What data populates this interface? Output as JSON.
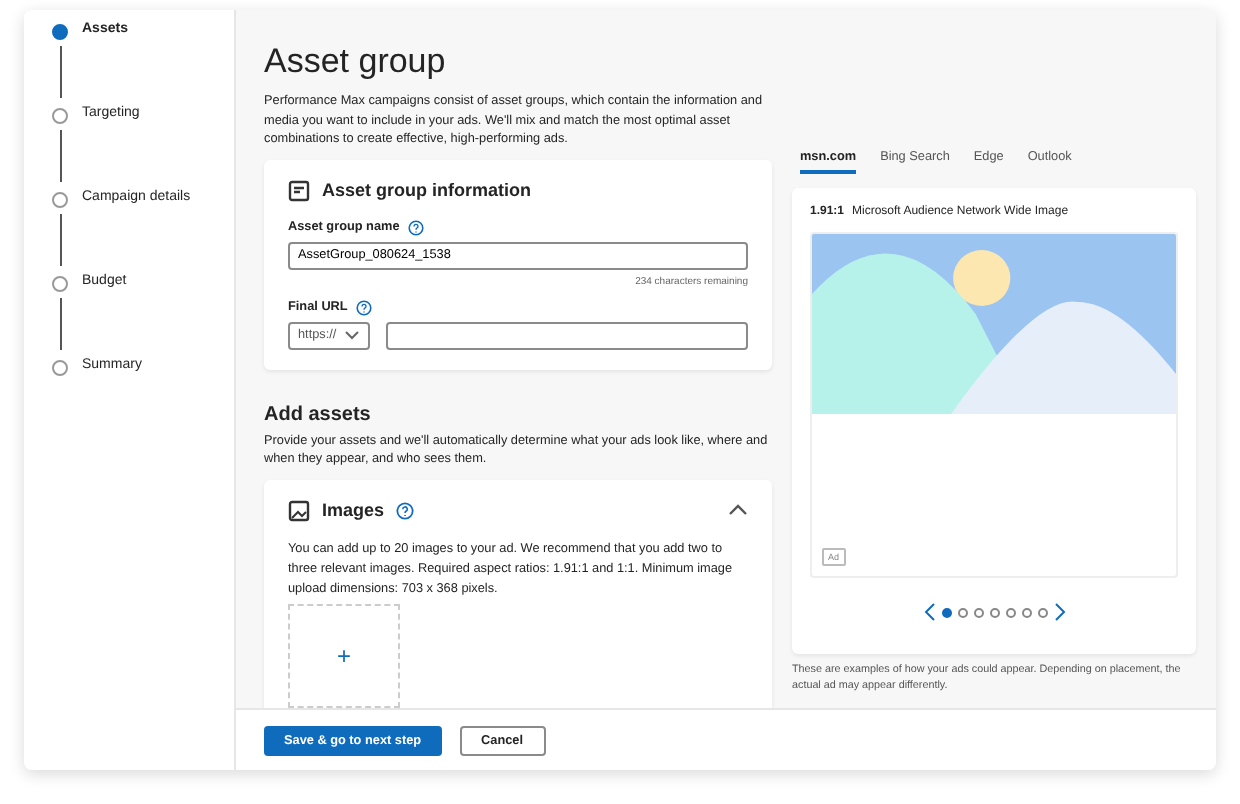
{
  "steps": [
    {
      "label": "Assets",
      "selected": true
    },
    {
      "label": "Targeting",
      "selected": false
    },
    {
      "label": "Campaign details",
      "selected": false
    },
    {
      "label": "Budget",
      "selected": false
    },
    {
      "label": "Summary",
      "selected": false
    }
  ],
  "title": "Asset group",
  "intro": "Performance Max campaigns consist of asset groups, which contain the information and media you want to include in your ads. We'll mix and match the most optimal asset combinations to create effective, high-performing ads.",
  "info_card": {
    "title": "Asset group information",
    "name_label": "Asset group name",
    "name_value": "AssetGroup_080624_1538",
    "remaining": "234 characters remaining",
    "url_label": "Final URL",
    "protocol": "https://"
  },
  "add_assets": {
    "title": "Add assets",
    "text": "Provide your assets and we'll automatically determine what your ads look like, where and when they appear, and who sees them.",
    "images": {
      "title": "Images",
      "expanded": true,
      "text": "You can add up to 20 images to your ad. We recommend that you add two to three relevant images. Required aspect ratios: 1.91:1 and 1:1. Minimum image upload dimensions: 703 x 368 pixels.",
      "add": "+"
    }
  },
  "preview": {
    "tabs": [
      {
        "label": "msn.com",
        "selected": true
      },
      {
        "label": "Bing Search",
        "selected": false
      },
      {
        "label": "Edge",
        "selected": false
      },
      {
        "label": "Outlook",
        "selected": false
      }
    ],
    "ratio": "1.91:1",
    "format": "Microsoft Audience Network Wide Image",
    "ad_badge": "Ad",
    "dots": [
      {
        "selected": true
      },
      {
        "selected": false
      },
      {
        "selected": false
      },
      {
        "selected": false
      },
      {
        "selected": false
      },
      {
        "selected": false
      },
      {
        "selected": false
      }
    ],
    "note": "These are examples of how your ads could appear. Depending on placement, the actual ad may appear differently."
  },
  "buttons": {
    "primary": "Save & go to next step",
    "secondary": "Cancel"
  }
}
